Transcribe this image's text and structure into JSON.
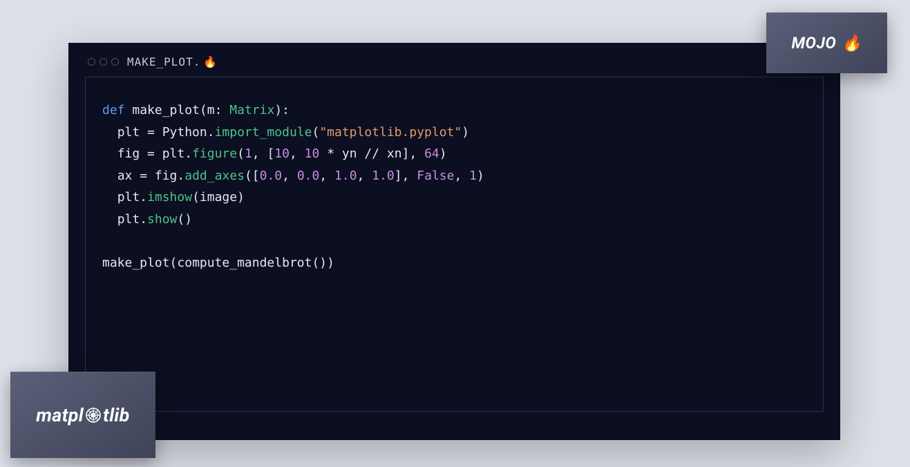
{
  "window": {
    "file_name": "MAKE_PLOT.",
    "file_icon": "🔥"
  },
  "code": {
    "lines": [
      {
        "indent": 0,
        "tokens": [
          {
            "t": "def ",
            "c": "kw"
          },
          {
            "t": "make_plot",
            "c": "fn"
          },
          {
            "t": "(",
            "c": "punct"
          },
          {
            "t": "m",
            "c": "ident"
          },
          {
            "t": ": ",
            "c": "punct"
          },
          {
            "t": "Matrix",
            "c": "type"
          },
          {
            "t": "):",
            "c": "punct"
          }
        ]
      },
      {
        "indent": 1,
        "tokens": [
          {
            "t": "plt = Python.",
            "c": "ident"
          },
          {
            "t": "import_module",
            "c": "method"
          },
          {
            "t": "(",
            "c": "punct"
          },
          {
            "t": "\"matplotlib.pyplot\"",
            "c": "str"
          },
          {
            "t": ")",
            "c": "punct"
          }
        ]
      },
      {
        "indent": 1,
        "tokens": [
          {
            "t": "fig = plt.",
            "c": "ident"
          },
          {
            "t": "figure",
            "c": "method"
          },
          {
            "t": "(",
            "c": "punct"
          },
          {
            "t": "1",
            "c": "num"
          },
          {
            "t": ", [",
            "c": "punct"
          },
          {
            "t": "10",
            "c": "num"
          },
          {
            "t": ", ",
            "c": "punct"
          },
          {
            "t": "10",
            "c": "num"
          },
          {
            "t": " * yn // xn], ",
            "c": "ident"
          },
          {
            "t": "64",
            "c": "num"
          },
          {
            "t": ")",
            "c": "punct"
          }
        ]
      },
      {
        "indent": 1,
        "tokens": [
          {
            "t": "ax = fig.",
            "c": "ident"
          },
          {
            "t": "add_axes",
            "c": "method"
          },
          {
            "t": "([",
            "c": "punct"
          },
          {
            "t": "0.0",
            "c": "num"
          },
          {
            "t": ", ",
            "c": "punct"
          },
          {
            "t": "0.0",
            "c": "num"
          },
          {
            "t": ", ",
            "c": "punct"
          },
          {
            "t": "1.0",
            "c": "num"
          },
          {
            "t": ", ",
            "c": "punct"
          },
          {
            "t": "1.0",
            "c": "num"
          },
          {
            "t": "], ",
            "c": "punct"
          },
          {
            "t": "False",
            "c": "bool"
          },
          {
            "t": ", ",
            "c": "punct"
          },
          {
            "t": "1",
            "c": "num"
          },
          {
            "t": ")",
            "c": "punct"
          }
        ]
      },
      {
        "indent": 1,
        "tokens": [
          {
            "t": "plt.",
            "c": "ident"
          },
          {
            "t": "imshow",
            "c": "method"
          },
          {
            "t": "(image)",
            "c": "ident"
          }
        ]
      },
      {
        "indent": 1,
        "tokens": [
          {
            "t": "plt.",
            "c": "ident"
          },
          {
            "t": "show",
            "c": "method"
          },
          {
            "t": "()",
            "c": "punct"
          }
        ]
      },
      {
        "indent": 0,
        "tokens": []
      },
      {
        "indent": 0,
        "tokens": [
          {
            "t": "make_plot",
            "c": "fn"
          },
          {
            "t": "(",
            "c": "punct"
          },
          {
            "t": "compute_mandelbrot",
            "c": "fn"
          },
          {
            "t": "())",
            "c": "punct"
          }
        ]
      }
    ]
  },
  "badges": {
    "mojo_label": "MOJO",
    "mojo_icon": "🔥",
    "matplotlib_prefix": "matpl",
    "matplotlib_suffix": "tlib"
  }
}
